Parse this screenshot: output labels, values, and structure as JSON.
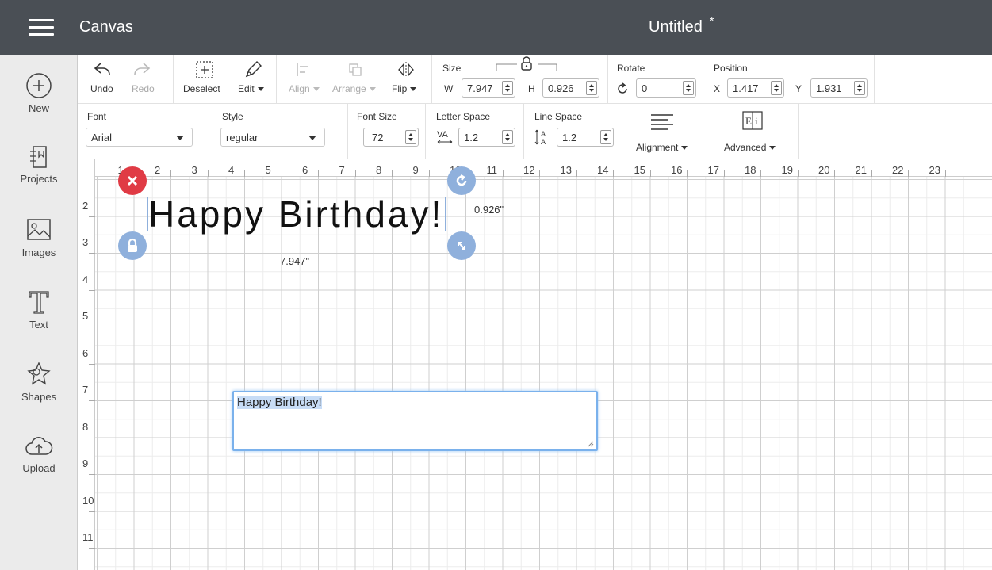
{
  "header": {
    "menu_icon": "hamburger-icon",
    "app_title": "Canvas",
    "document_title": "Untitled",
    "unsaved_marker": "*"
  },
  "sidebar": {
    "items": [
      {
        "label": "New",
        "icon": "plus-circle-icon"
      },
      {
        "label": "Projects",
        "icon": "projects-icon"
      },
      {
        "label": "Images",
        "icon": "image-icon"
      },
      {
        "label": "Text",
        "icon": "text-icon"
      },
      {
        "label": "Shapes",
        "icon": "shapes-icon"
      },
      {
        "label": "Upload",
        "icon": "cloud-upload-icon"
      }
    ]
  },
  "toolbar1": {
    "undo": "Undo",
    "redo": "Redo",
    "deselect": "Deselect",
    "edit": "Edit",
    "align": "Align",
    "arrange": "Arrange",
    "flip": "Flip",
    "size_label": "Size",
    "width_label": "W",
    "width_value": "7.947",
    "height_label": "H",
    "height_value": "0.926",
    "rotate_label": "Rotate",
    "rotate_value": "0",
    "position_label": "Position",
    "x_label": "X",
    "x_value": "1.417",
    "y_label": "Y",
    "y_value": "1.931"
  },
  "toolbar2": {
    "font_label": "Font",
    "font_value": "Arial",
    "style_label": "Style",
    "style_value": "regular",
    "font_size_label": "Font Size",
    "font_size_value": "72",
    "letter_space_label": "Letter Space",
    "letter_space_value": "1.2",
    "line_space_label": "Line Space",
    "line_space_value": "1.2",
    "alignment_label": "Alignment",
    "advanced_label": "Advanced"
  },
  "canvas": {
    "ruler_top": [
      "1",
      "2",
      "3",
      "4",
      "5",
      "6",
      "7",
      "8",
      "9",
      "10",
      "11",
      "12",
      "13",
      "14",
      "15",
      "16",
      "17",
      "18",
      "19",
      "20",
      "21",
      "22",
      "23"
    ],
    "ruler_left": [
      "2",
      "3",
      "4",
      "5",
      "6",
      "7",
      "8",
      "9",
      "10",
      "11"
    ],
    "text_object": "Happy Birthday!",
    "height_dimension": "0.926\"",
    "width_dimension": "7.947\"",
    "text_edit_value": "Happy Birthday!"
  }
}
